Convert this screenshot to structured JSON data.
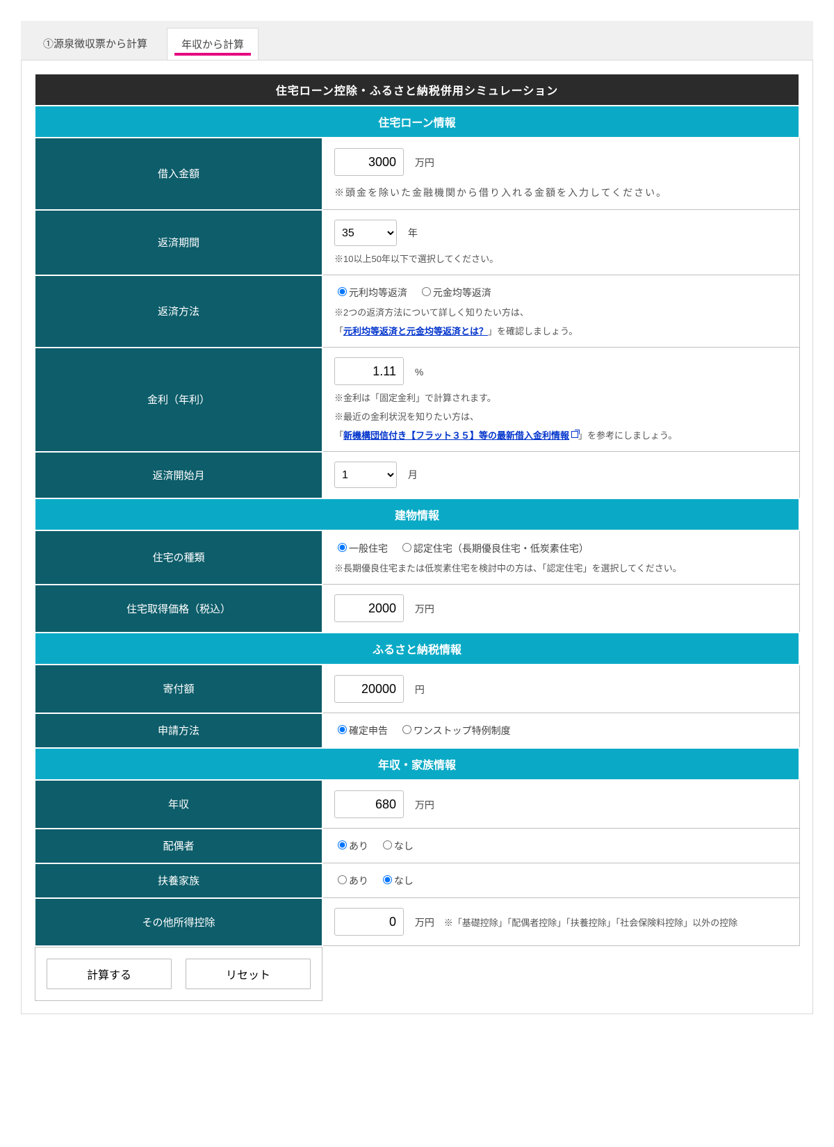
{
  "tabs": {
    "tab1": "①源泉徴収票から計算",
    "tab2": "年収から計算"
  },
  "title": "住宅ローン控除・ふるさと納税併用シミュレーション",
  "sections": {
    "loan": "住宅ローン情報",
    "building": "建物情報",
    "furusato": "ふるさと納税情報",
    "income": "年収・家族情報"
  },
  "loanAmount": {
    "label": "借入金額",
    "value": "3000",
    "unit": "万円",
    "note": "※頭金を除いた金融機関から借り入れる金額を入力してください。"
  },
  "repayTerm": {
    "label": "返済期間",
    "value": "35",
    "unit": "年",
    "note": "※10以上50年以下で選択してください。"
  },
  "repayMethod": {
    "label": "返済方法",
    "opt1": "元利均等返済",
    "opt2": "元金均等返済",
    "note1": "※2つの返済方法について詳しく知りたい方は、",
    "note2a": "「",
    "link": "元利均等返済と元金均等返済とは？",
    "note2b": "」を確認しましょう。"
  },
  "rate": {
    "label": "金利（年利）",
    "value": "1.11",
    "unit": "%",
    "note1": "※金利は「固定金利」で計算されます。",
    "note2": "※最近の金利状況を知りたい方は、",
    "note3a": "「",
    "link": "新機構団信付き【フラット３５】等の最新借入金利情報",
    "note3b": "」を参考にしましょう。"
  },
  "startMonth": {
    "label": "返済開始月",
    "value": "1",
    "unit": "月"
  },
  "houseType": {
    "label": "住宅の種類",
    "opt1": "一般住宅",
    "opt2": "認定住宅（長期優良住宅・低炭素住宅）",
    "note": "※長期優良住宅または低炭素住宅を検討中の方は、「認定住宅」を選択してください。"
  },
  "housePrice": {
    "label": "住宅取得価格（税込）",
    "value": "2000",
    "unit": "万円"
  },
  "donation": {
    "label": "寄付額",
    "value": "20000",
    "unit": "円"
  },
  "applyMethod": {
    "label": "申請方法",
    "opt1": "確定申告",
    "opt2": "ワンストップ特例制度"
  },
  "income": {
    "label": "年収",
    "value": "680",
    "unit": "万円"
  },
  "spouse": {
    "label": "配偶者",
    "opt1": "あり",
    "opt2": "なし"
  },
  "dependents": {
    "label": "扶養家族",
    "opt1": "あり",
    "opt2": "なし"
  },
  "otherDeduct": {
    "label": "その他所得控除",
    "value": "0",
    "unit": "万円",
    "note": "※「基礎控除」「配偶者控除」「扶養控除」「社会保険料控除」以外の控除"
  },
  "buttons": {
    "calc": "計算する",
    "reset": "リセット"
  }
}
